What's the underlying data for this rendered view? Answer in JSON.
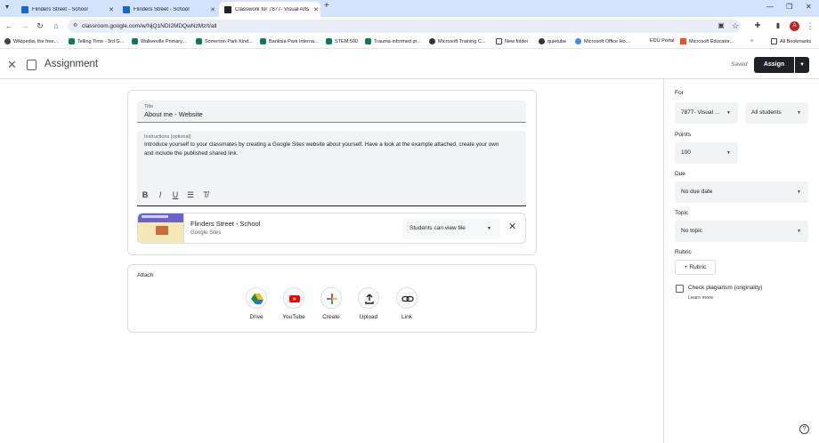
{
  "browser": {
    "tabs": [
      {
        "title": "Flinders Street - School"
      },
      {
        "title": "Flinders Street - School"
      },
      {
        "title": "Classwork for 7877- Visual Arts"
      }
    ],
    "new_tab": "+",
    "url": "classroom.google.com/w/NjQ1NDI2MDQwNzMz/t/all",
    "profile_initial": "A",
    "bookmarks": [
      "Wikipedia, the free...",
      "Telling Time - 3rd G...",
      "Walkerville Primary...",
      "Somerton Park Kind...",
      "Banksia Park Interna...",
      "STEM:500",
      "Trauma-informed pr...",
      "Microsoft Training C...",
      "New folder",
      "quietube",
      "Microsoft Office Ho...",
      "EDU Portal",
      "Microsoft Educator...",
      "All Bookmarks"
    ]
  },
  "header": {
    "title": "Assignment",
    "saved": "Saved",
    "assign_label": "Assign"
  },
  "form": {
    "title_label": "Title",
    "title_value": "About me - Website",
    "instructions_label": "Instructions (optional)",
    "instructions_value": "Introduce yourself to your classmates by creating a Google Sites website about yourself.  Have a look at the example attached, create your own and include the published shared link.",
    "format_buttons": [
      "B",
      "I",
      "U"
    ],
    "attachment": {
      "title": "Flinders Street - School",
      "subtitle": "Google Sites",
      "permission": "Students can view file"
    }
  },
  "attach": {
    "heading": "Attach",
    "items": [
      {
        "label": "Drive",
        "icon": "drive-icon"
      },
      {
        "label": "YouTube",
        "icon": "youtube-icon"
      },
      {
        "label": "Create",
        "icon": "plus-icon"
      },
      {
        "label": "Upload",
        "icon": "upload-icon"
      },
      {
        "label": "Link",
        "icon": "link-icon"
      }
    ]
  },
  "sidebar": {
    "for_label": "For",
    "class_value": "7877- Visual ...",
    "students_value": "All students",
    "points_label": "Points",
    "points_value": "100",
    "due_label": "Due",
    "due_value": "No due date",
    "topic_label": "Topic",
    "topic_value": "No topic",
    "rubric_label": "Rubric",
    "rubric_button": "Rubric",
    "plagiarism_label": "Check plagiarism (originality)",
    "learn_more": "Learn more"
  },
  "colors": {
    "accent": "#202124",
    "tabstrip": "#d3e3fd",
    "field_bg": "#f1f3f4"
  }
}
